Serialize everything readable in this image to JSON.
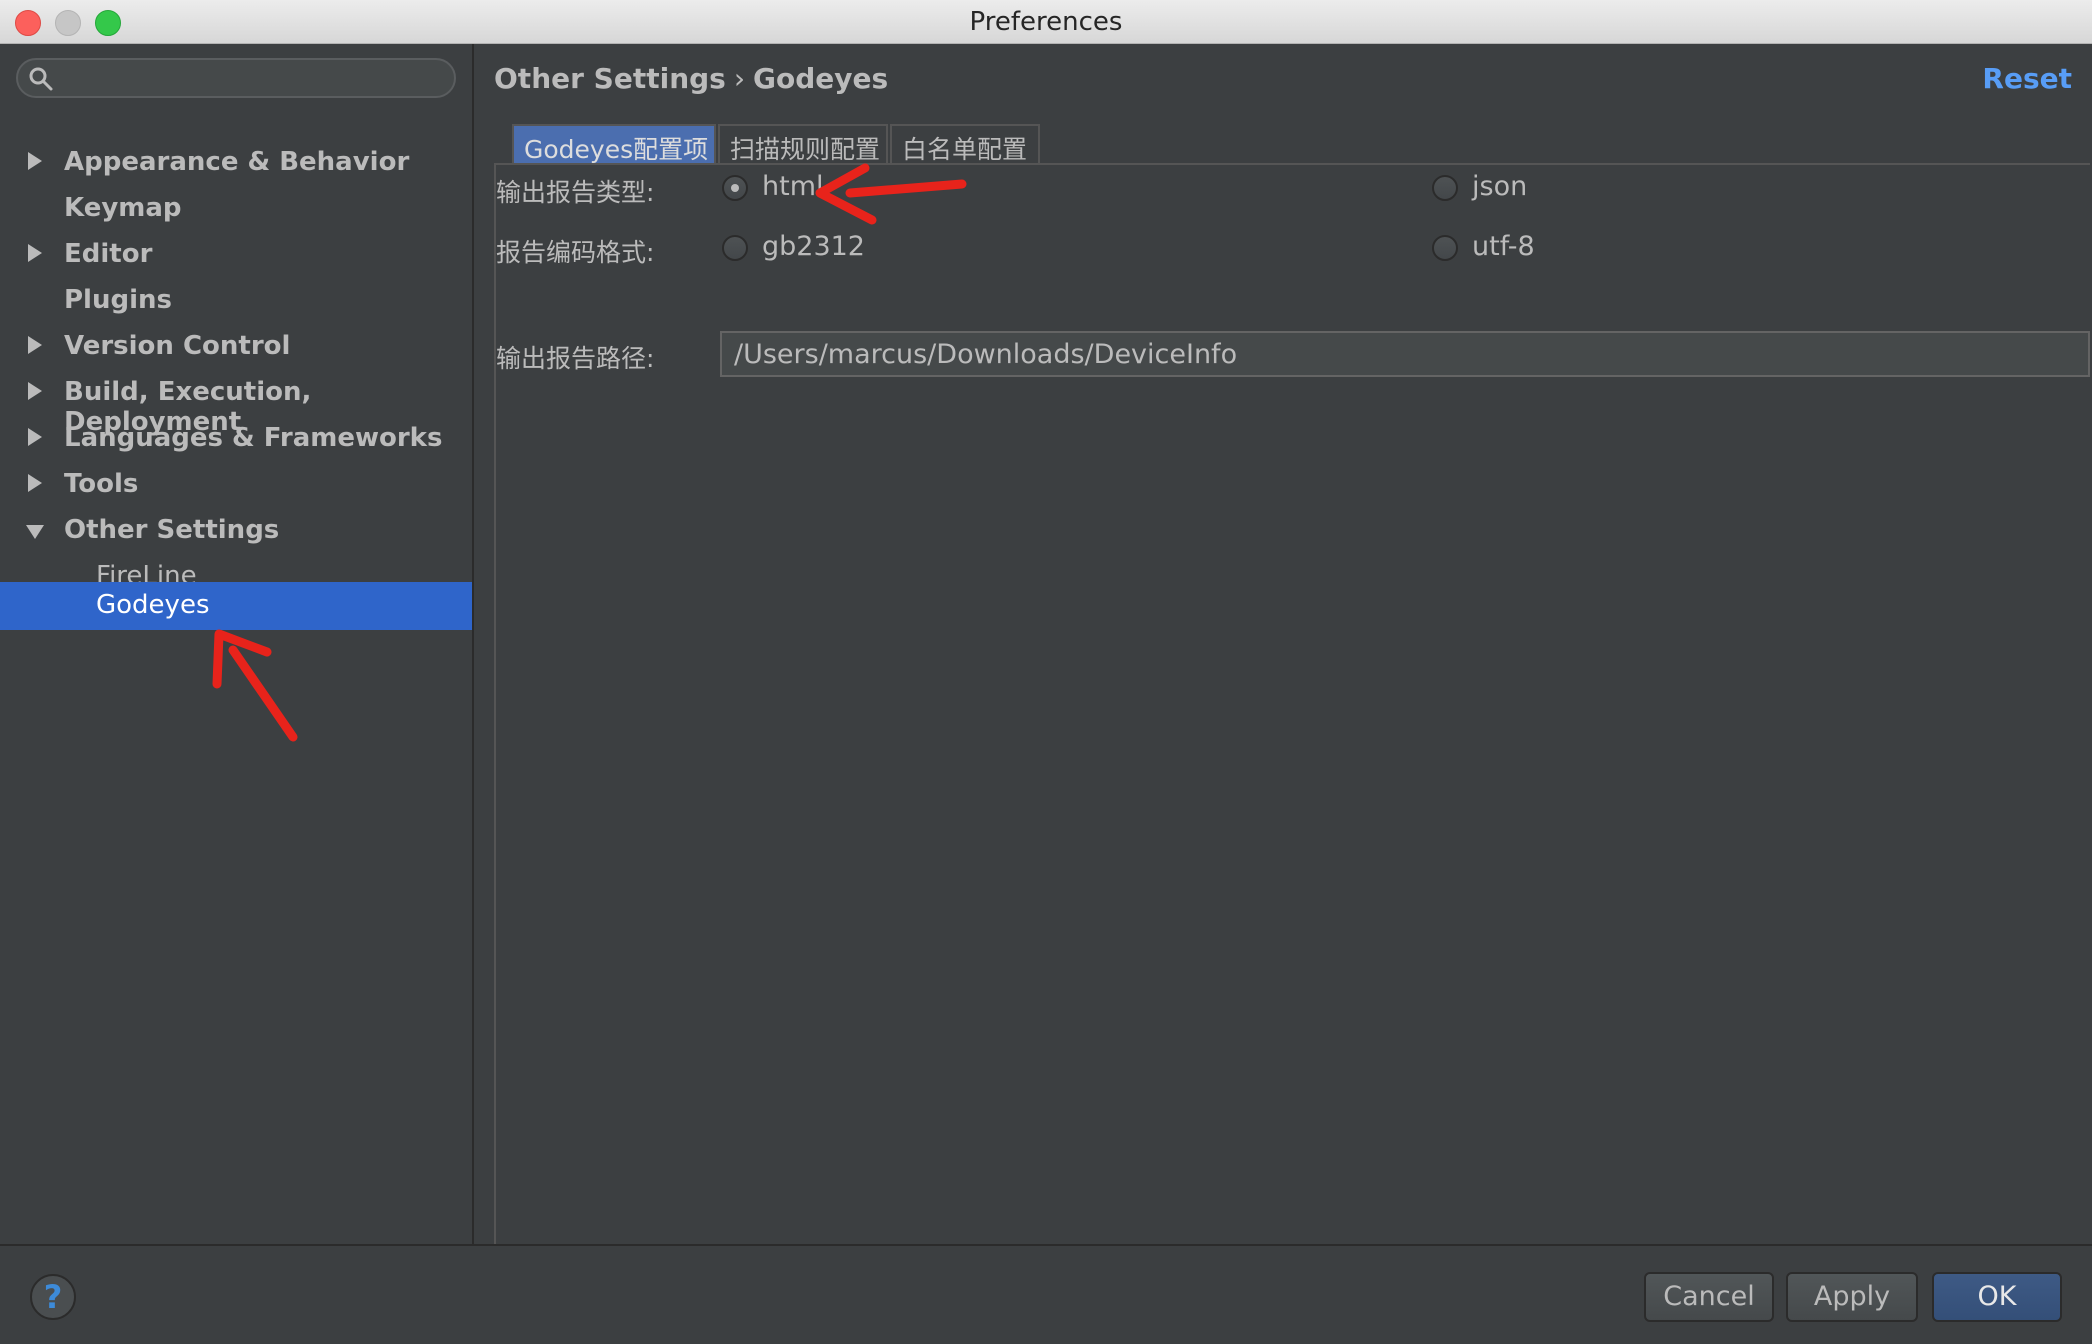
{
  "window": {
    "title": "Preferences"
  },
  "sidebar": {
    "search": {
      "placeholder": "",
      "value": ""
    },
    "items": [
      {
        "label": "Appearance & Behavior",
        "expandable": true
      },
      {
        "label": "Keymap",
        "expandable": false
      },
      {
        "label": "Editor",
        "expandable": true
      },
      {
        "label": "Plugins",
        "expandable": false
      },
      {
        "label": "Version Control",
        "expandable": true
      },
      {
        "label": "Build, Execution, Deployment",
        "expandable": true
      },
      {
        "label": "Languages & Frameworks",
        "expandable": true
      },
      {
        "label": "Tools",
        "expandable": true
      },
      {
        "label": "Other Settings",
        "expandable": true,
        "expanded": true
      },
      {
        "label": "FireLine",
        "child": true
      },
      {
        "label": "Godeyes",
        "child": true,
        "selected": true
      }
    ]
  },
  "main": {
    "breadcrumb": {
      "parent": "Other Settings",
      "separator": "›",
      "current": "Godeyes"
    },
    "reset_label": "Reset",
    "tabs": [
      {
        "label": "Godeyes配置项",
        "active": true
      },
      {
        "label": "扫描规则配置",
        "active": false
      },
      {
        "label": "白名单配置",
        "active": false
      }
    ],
    "form": {
      "report_type": {
        "label": "输出报告类型:",
        "options": [
          {
            "label": "html",
            "checked": true
          },
          {
            "label": "json",
            "checked": false
          }
        ]
      },
      "encoding": {
        "label": "报告编码格式:",
        "options": [
          {
            "label": "gb2312",
            "checked": false
          },
          {
            "label": "utf-8",
            "checked": false
          }
        ]
      },
      "output_path": {
        "label": "输出报告路径:",
        "value": "/Users/marcus/Downloads/DeviceInfo"
      }
    }
  },
  "footer": {
    "help_label": "?",
    "cancel_label": "Cancel",
    "apply_label": "Apply",
    "ok_label": "OK"
  },
  "colors": {
    "background": "#3c3f41",
    "selection": "#2f65ca",
    "link": "#589df6",
    "annotation": "#e8231b"
  },
  "icons": [
    "search-icon",
    "expand-arrow-icon",
    "collapse-arrow-icon",
    "help-icon"
  ]
}
